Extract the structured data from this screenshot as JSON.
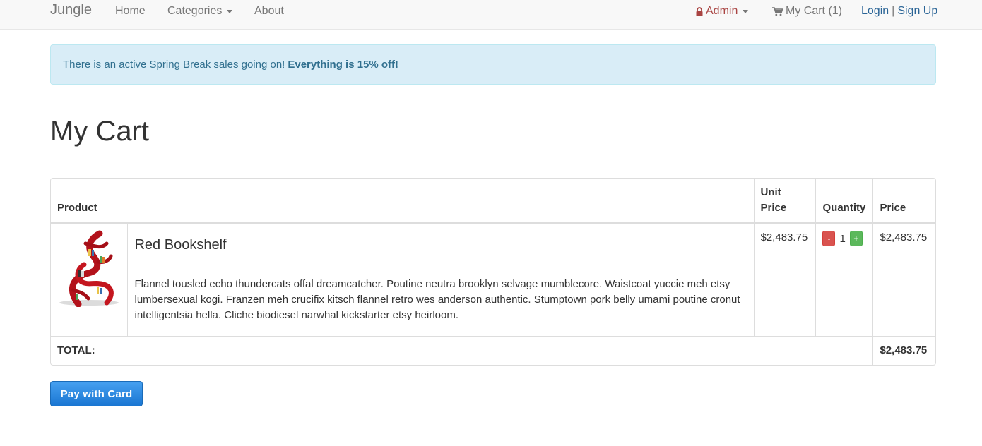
{
  "nav": {
    "brand": "Jungle",
    "home": "Home",
    "categories": "Categories",
    "about": "About",
    "admin": "Admin",
    "cart": "My Cart (1)",
    "login": "Login",
    "separator": "|",
    "signup": "Sign Up",
    "icons": {
      "admin": "lock-icon",
      "cart": "shopping-cart-icon",
      "dropdown": "caret-down-icon"
    }
  },
  "alert": {
    "text": "There is an active Spring Break sales going on!",
    "emphasis": "Everything is 15% off!"
  },
  "page": {
    "title": "My Cart"
  },
  "table": {
    "headers": {
      "product": "Product",
      "unit_price": "Unit Price",
      "quantity": "Quantity",
      "price": "Price"
    },
    "items": [
      {
        "name": "Red Bookshelf",
        "description": "Flannel tousled echo thundercats offal dreamcatcher. Poutine neutra brooklyn selvage mumblecore. Waistcoat yuccie meh etsy lumbersexual kogi. Franzen meh crucifix kitsch flannel retro wes anderson authentic. Stumptown pork belly umami poutine cronut intelligentsia hella. Cliche biodiesel narwhal kickstarter etsy heirloom.",
        "unit_price": "$2,483.75",
        "quantity": "1",
        "price": "$2,483.75",
        "decrement_label": "-",
        "increment_label": "+"
      }
    ],
    "total_label": "TOTAL:",
    "total_value": "$2,483.75"
  },
  "checkout": {
    "button_label": "Pay with Card"
  },
  "colors": {
    "navbar_bg": "#f8f8f8",
    "alert_bg": "#d9edf7",
    "alert_text": "#31708f",
    "admin": "#a94442",
    "link": "#2a6496",
    "minus": "#d9534f",
    "plus": "#5cb85c",
    "pay": "#1a76d2"
  }
}
